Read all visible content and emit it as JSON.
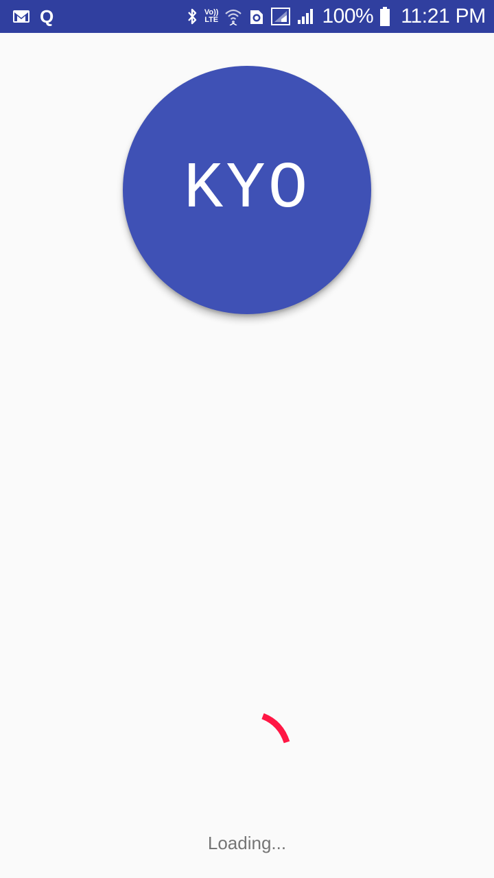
{
  "status_bar": {
    "left_icons": [
      "gmail-icon",
      "q-icon"
    ],
    "q_label": "Q",
    "volte_top": "Vo))",
    "volte_bottom": "LTE",
    "right_icons": [
      "bluetooth-icon",
      "volte-lte-icon",
      "wifi-icon",
      "data-saver-icon",
      "signal-sim1-icon",
      "signal-sim2-icon",
      "battery-icon"
    ],
    "battery_percent": "100%",
    "battery_level": 1.0,
    "time": "11:21 PM",
    "background_color": "#303f9f"
  },
  "logo": {
    "text": "KYO",
    "circle_color": "#3f51b5",
    "text_color": "#ffffff"
  },
  "spinner": {
    "color": "#ff1744",
    "icon": "loading-spinner-icon"
  },
  "loading_label": "Loading..."
}
